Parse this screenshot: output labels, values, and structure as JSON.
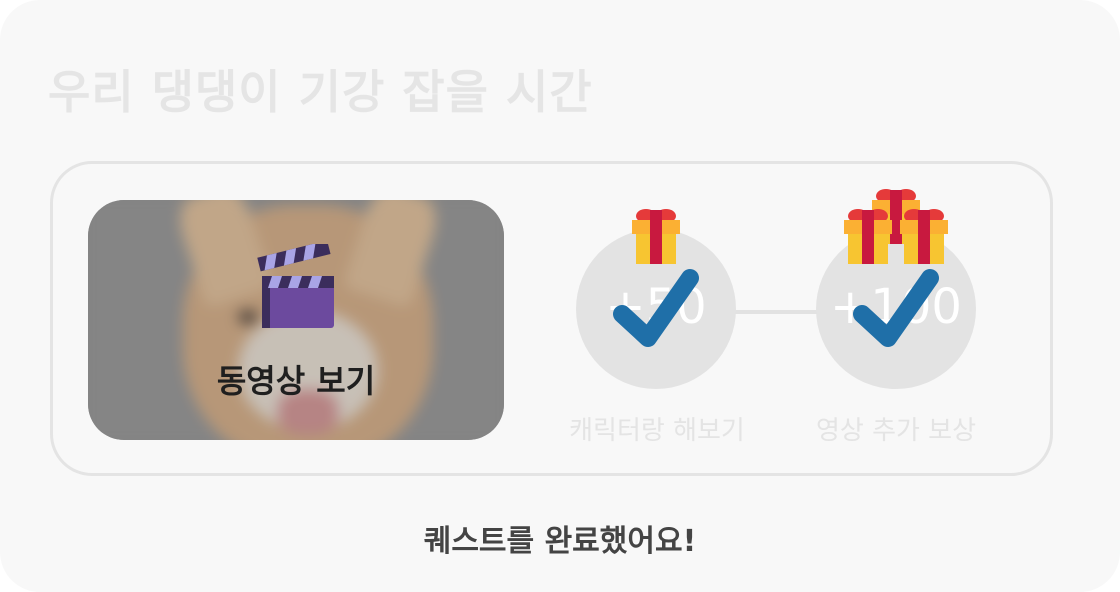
{
  "title": "우리 댕댕이 기강 잡을 시간",
  "video": {
    "label": "동영상 보기",
    "icon": "clapperboard-icon"
  },
  "rewards": [
    {
      "amount": "+50",
      "label": "캐릭터랑 해보기",
      "completed": true,
      "gift_icon": "gift-icon"
    },
    {
      "amount": "+100",
      "label": "영상 추가 보상",
      "completed": true,
      "gift_icon": "gift-stack-icon"
    }
  ],
  "status_message": "퀘스트를 완료했어요!",
  "colors": {
    "check": "#1f6fa8",
    "gift_box": "#f7c531",
    "gift_ribbon": "#d81e4a",
    "card_bg": "#f8f8f8"
  }
}
